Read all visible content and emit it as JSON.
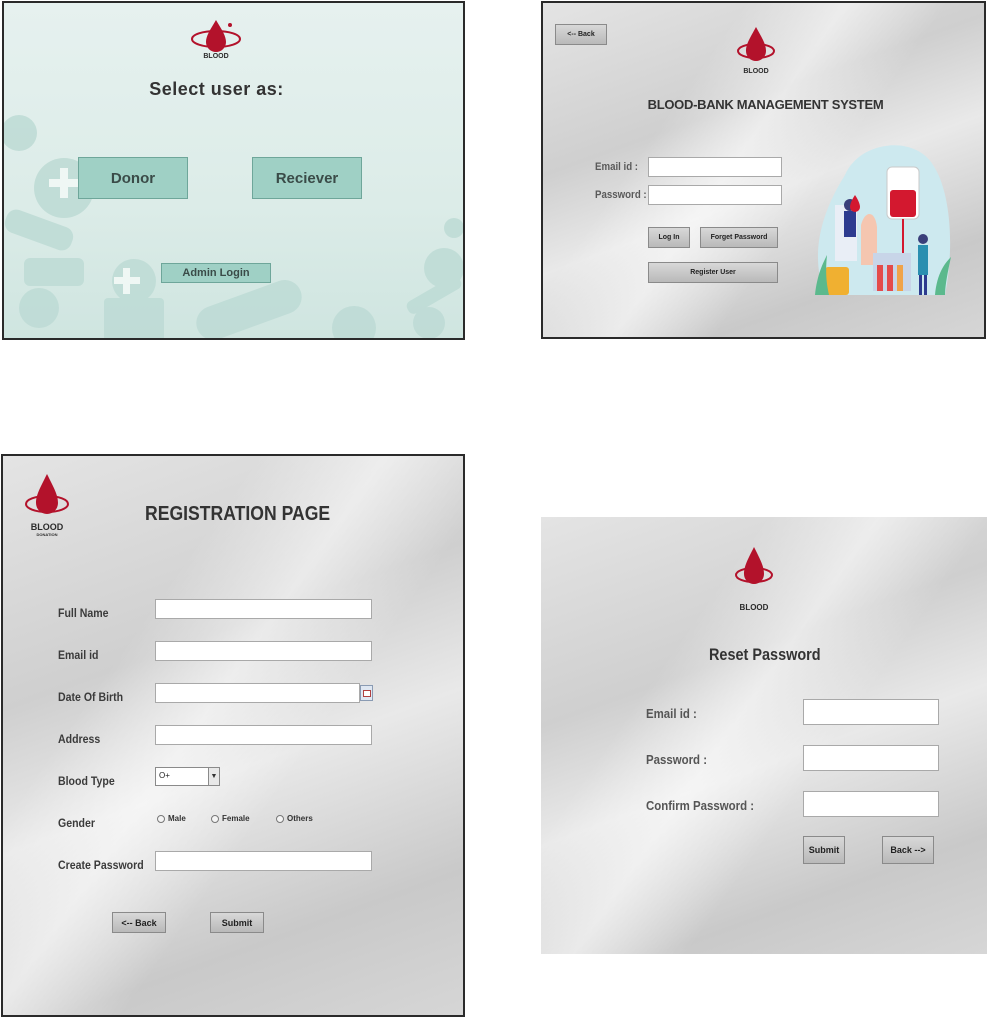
{
  "brand": {
    "logo_text": "BLOOD",
    "logo_subtext": "DONATION",
    "drop_color": "#b3122b"
  },
  "select_user": {
    "title": "Select user as:",
    "donor_label": "Donor",
    "receiver_label": "Reciever",
    "admin_label": "Admin Login",
    "button_color": "#9fd0c5"
  },
  "login": {
    "back_label": "<-- Back",
    "title": "BLOOD-BANK MANAGEMENT SYSTEM",
    "email_label": "Email id :",
    "password_label": "Password :",
    "email_value": "",
    "password_value": "",
    "login_label": "Log In",
    "forget_label": "Forget Password",
    "register_label": "Register User",
    "illustration_icon": "blood-donation-illustration"
  },
  "registration": {
    "title": "REGISTRATION PAGE",
    "full_name_label": "Full Name",
    "email_label": "Email id",
    "dob_label": "Date Of Birth",
    "address_label": "Address",
    "blood_type_label": "Blood Type",
    "blood_type_value": "O+",
    "gender_label": "Gender",
    "gender_options": [
      "Male",
      "Female",
      "Others"
    ],
    "password_label": "Create Password",
    "back_label": "<-- Back",
    "submit_label": "Submit",
    "calendar_icon": "calendar-icon"
  },
  "reset": {
    "title": "Reset Password",
    "email_label": "Email id :",
    "password_label": "Password :",
    "confirm_label": "Confirm Password :",
    "submit_label": "Submit",
    "back_label": "Back -->"
  }
}
